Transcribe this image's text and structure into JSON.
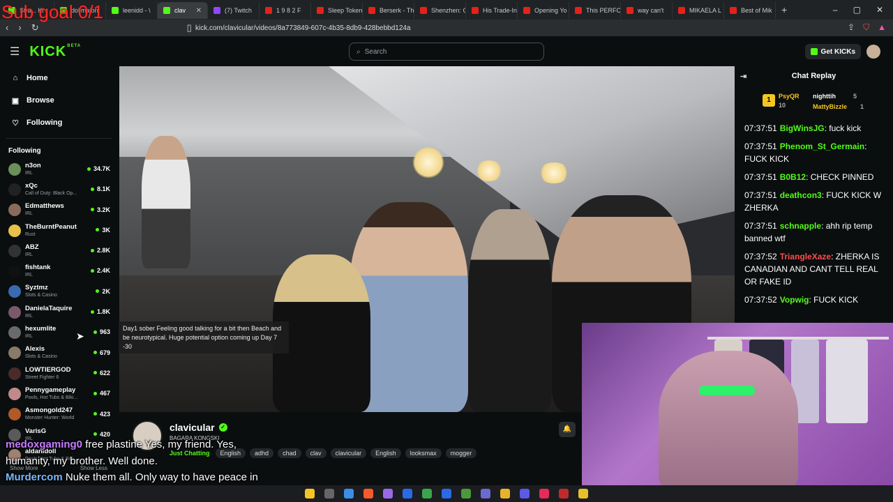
{
  "browser": {
    "tabs": [
      {
        "title": "Stra... Ki",
        "color": "#53fc18"
      },
      {
        "title": "dollmaion",
        "color": "#53fc18"
      },
      {
        "title": "leenidd - \\",
        "color": "#53fc18"
      },
      {
        "title": "clav",
        "color": "#53fc18",
        "active": true
      },
      {
        "title": "(7) Twitch",
        "color": "#9146ff"
      },
      {
        "title": "1 9 8 2   F",
        "color": "#e62117"
      },
      {
        "title": "Sleep Token",
        "color": "#e62117"
      },
      {
        "title": "Berserk - Th",
        "color": "#e62117"
      },
      {
        "title": "Shenzhen: C",
        "color": "#e62117"
      },
      {
        "title": "His Trade-In",
        "color": "#e62117"
      },
      {
        "title": "Opening Yo",
        "color": "#e62117"
      },
      {
        "title": "This PERFO",
        "color": "#e62117"
      },
      {
        "title": "way can't",
        "color": "#e62117"
      },
      {
        "title": "MIKAELA L",
        "color": "#e62117"
      },
      {
        "title": "Best of Mik",
        "color": "#e62117"
      }
    ],
    "url": "kick.com/clavicular/videos/8a773849-607c-4b35-8db9-428bebbd124a"
  },
  "overlay_top": "Sub goal 0/1",
  "site": {
    "logo": "KICK",
    "beta": "BETA",
    "search_placeholder": "Search",
    "get_kicks": "Get KICKs"
  },
  "sidebar": {
    "nav": [
      {
        "label": "Home",
        "icon": "home-icon",
        "glyph": "⌂"
      },
      {
        "label": "Browse",
        "icon": "browse-icon",
        "glyph": "▣"
      },
      {
        "label": "Following",
        "icon": "heart-icon",
        "glyph": "♡"
      }
    ],
    "following_label": "Following",
    "channels": [
      {
        "name": "n3on",
        "category": "IRL",
        "viewers": "34.7K",
        "color": "#6a8f5a"
      },
      {
        "name": "xQc",
        "category": "Call of Duty: Black Op...",
        "viewers": "8.1K",
        "color": "#222"
      },
      {
        "name": "Edmatthews",
        "category": "IRL",
        "viewers": "3.2K",
        "color": "#8a6a5a"
      },
      {
        "name": "TheBurntPeanut",
        "category": "Rust",
        "viewers": "3K",
        "color": "#e8c04a"
      },
      {
        "name": "ABZ",
        "category": "IRL",
        "viewers": "2.8K",
        "color": "#333"
      },
      {
        "name": "fishtank",
        "category": "IRL",
        "viewers": "2.4K",
        "color": "#111"
      },
      {
        "name": "Syztmz",
        "category": "Slots & Casino",
        "viewers": "2K",
        "color": "#3a6ab0"
      },
      {
        "name": "DanielaTaquire",
        "category": "IRL",
        "viewers": "1.8K",
        "color": "#7a5a6a"
      },
      {
        "name": "hexumlite",
        "category": "IRL",
        "viewers": "963",
        "color": "#6a6a6a"
      },
      {
        "name": "Alexis",
        "category": "Slots & Casino",
        "viewers": "679",
        "color": "#8a7a6a"
      },
      {
        "name": "LOWTIERGOD",
        "category": "Street Fighter 6",
        "viewers": "622",
        "color": "#4a2a2a"
      },
      {
        "name": "Pennygameplay",
        "category": "Pools, Hot Tubs & Biki...",
        "viewers": "467",
        "color": "#c08a8a"
      },
      {
        "name": "Asmongold247",
        "category": "Monster Hunter: World",
        "viewers": "423",
        "color": "#b05a2a"
      },
      {
        "name": "VarisG",
        "category": "IRL",
        "viewers": "420",
        "color": "#5a5a5a"
      },
      {
        "name": "aldanidoll",
        "category": "Pools, Hot Tubs & Biki...",
        "viewers": "",
        "color": "#a08070"
      }
    ],
    "show_more": "Show More",
    "show_less": "Show Less"
  },
  "video": {
    "caption": "Day1 sober Feeling good talking for a bit then Beach and be neurotypical. Huge potential option coming up Day 7 -30"
  },
  "stream": {
    "name": "clavicular",
    "title": "BAGARA KONGSKI",
    "category": "Just Chatting",
    "tags": [
      "English",
      "adhd",
      "chad",
      "clav",
      "clavicular",
      "English",
      "looksmax",
      "mogger"
    ]
  },
  "chat": {
    "header": "Chat Replay",
    "gifters": [
      {
        "name": "PsyQR",
        "count": "10",
        "color": "#f5c623"
      },
      {
        "name": "nighttih",
        "count": "5",
        "color": "#ffffff"
      },
      {
        "name": "MattyBizzle",
        "count": "1",
        "color": "#f5c623"
      }
    ],
    "messages": [
      {
        "time": "07:37:51",
        "user": "BigWinsJG",
        "color": "#53fc18",
        "text": ": fuck kick"
      },
      {
        "time": "07:37:51",
        "user": "Phenom_St_Germain",
        "color": "#53fc18",
        "text": ": FUCK KICK"
      },
      {
        "time": "07:37:51",
        "user": "B0B12",
        "color": "#53fc18",
        "text": ": CHECK PINNED"
      },
      {
        "time": "07:37:51",
        "user": "deathcon3",
        "color": "#53fc18",
        "text": ": FUCK KICK W ZHERKA"
      },
      {
        "time": "07:37:51",
        "user": "schnapple",
        "color": "#53fc18",
        "text": ": ahh rip temp banned wtf"
      },
      {
        "time": "07:37:52",
        "user": "TriangleXaze",
        "color": "#ff4d4d",
        "text": ": ZHERKA IS CANADIAN AND CANT TELL REAL OR FAKE ID"
      },
      {
        "time": "07:37:52",
        "user": "Vopwig",
        "color": "#53fc18",
        "text": ": FUCK KICK"
      }
    ]
  },
  "overlay_chat": [
    {
      "user": "medoxgaming0",
      "text": " free plastine Yes, my friend. Yes, humanity, my brother. Well done."
    },
    {
      "user": "Murdercom",
      "text": " Nuke them all. Only way to have peace in the middle east"
    }
  ]
}
